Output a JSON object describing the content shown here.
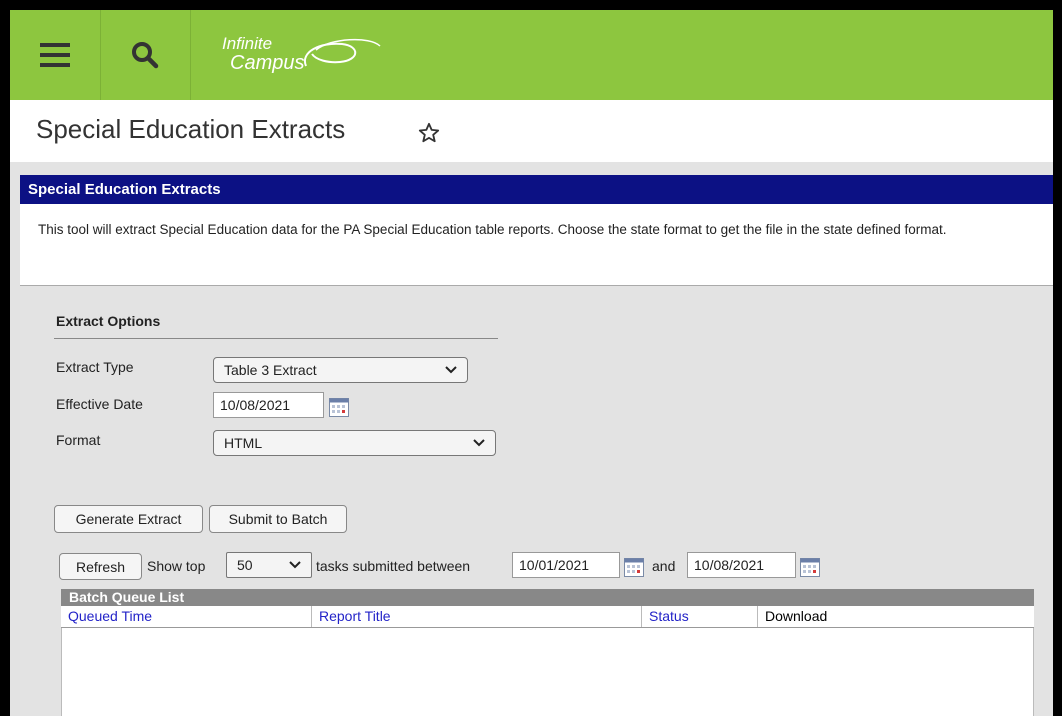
{
  "header": {
    "logo_line1": "Infinite",
    "logo_line2": "Campus",
    "colors": {
      "bar": "#8dc63f",
      "section": "#0c1184"
    },
    "icons": {
      "menu": "hamburger-menu-icon",
      "search": "search-icon",
      "favorite": "star-outline-icon",
      "calendar": "calendar-icon"
    }
  },
  "page": {
    "title": "Special Education Extracts"
  },
  "section": {
    "title": "Special Education Extracts",
    "description": "This tool will extract Special Education data for the PA Special Education table reports. Choose the state format to get the file in the state defined format."
  },
  "options": {
    "title": "Extract Options",
    "extract_type_label": "Extract Type",
    "extract_type_value": "Table 3 Extract",
    "effective_date_label": "Effective Date",
    "effective_date_value": "10/08/2021",
    "format_label": "Format",
    "format_value": "HTML"
  },
  "actions": {
    "generate": "Generate Extract",
    "submit": "Submit to Batch"
  },
  "batch_filter": {
    "refresh": "Refresh",
    "show_top": "Show top",
    "top_value": "50",
    "tasks_between": "tasks submitted between",
    "start_date": "10/01/2021",
    "and": "and",
    "end_date": "10/08/2021"
  },
  "batch_queue": {
    "title": "Batch Queue List",
    "columns": [
      "Queued Time",
      "Report Title",
      "Status",
      "Download"
    ]
  }
}
